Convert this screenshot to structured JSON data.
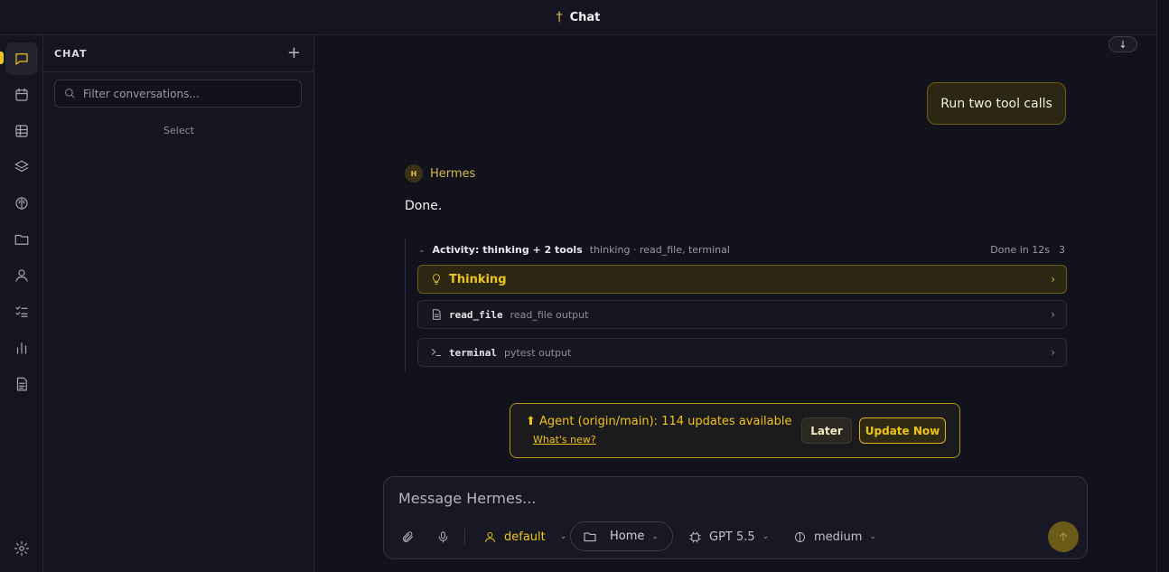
{
  "window": {
    "title": "Chat",
    "title_icon": "cross-icon"
  },
  "colors": {
    "accent": "#f0c419",
    "background": "#12121c",
    "panel": "#151521"
  },
  "rail": {
    "items": [
      {
        "icon": "chat-icon",
        "active": true
      },
      {
        "icon": "calendar-icon"
      },
      {
        "icon": "table-icon"
      },
      {
        "icon": "layers-icon"
      },
      {
        "icon": "brain-icon"
      },
      {
        "icon": "folder-icon"
      },
      {
        "icon": "user-icon"
      },
      {
        "icon": "checklist-icon"
      },
      {
        "icon": "bar-chart-icon"
      },
      {
        "icon": "document-icon"
      }
    ],
    "settings_icon": "gear-icon"
  },
  "sidebar": {
    "title": "CHAT",
    "add_label": "+",
    "search_placeholder": "Filter conversations...",
    "empty_label": "Select"
  },
  "scroll_button_label": "↓",
  "conversation": {
    "user_message": "Run two tool calls",
    "agent": {
      "avatar_letter": "H",
      "name": "Hermes",
      "message": "Done."
    },
    "activity": {
      "title": "Activity: thinking + 2 tools",
      "summary": "thinking · read_file, terminal",
      "status": "Done in 12s",
      "count": "3",
      "rows": [
        {
          "label": "Thinking",
          "icon": "lightbulb-icon"
        },
        {
          "tool": "read_file",
          "description": "read_file output",
          "icon": "file-icon"
        },
        {
          "tool": "terminal",
          "description": "pytest output",
          "icon": "terminal-icon"
        }
      ]
    }
  },
  "update_banner": {
    "title": "⬆ Agent (origin/main): 114 updates available",
    "link": "What's new?",
    "later_label": "Later",
    "update_label": "Update Now"
  },
  "composer": {
    "placeholder": "Message Hermes...",
    "profile": "default",
    "folder": "Home",
    "model": "GPT 5.5",
    "effort": "medium"
  }
}
